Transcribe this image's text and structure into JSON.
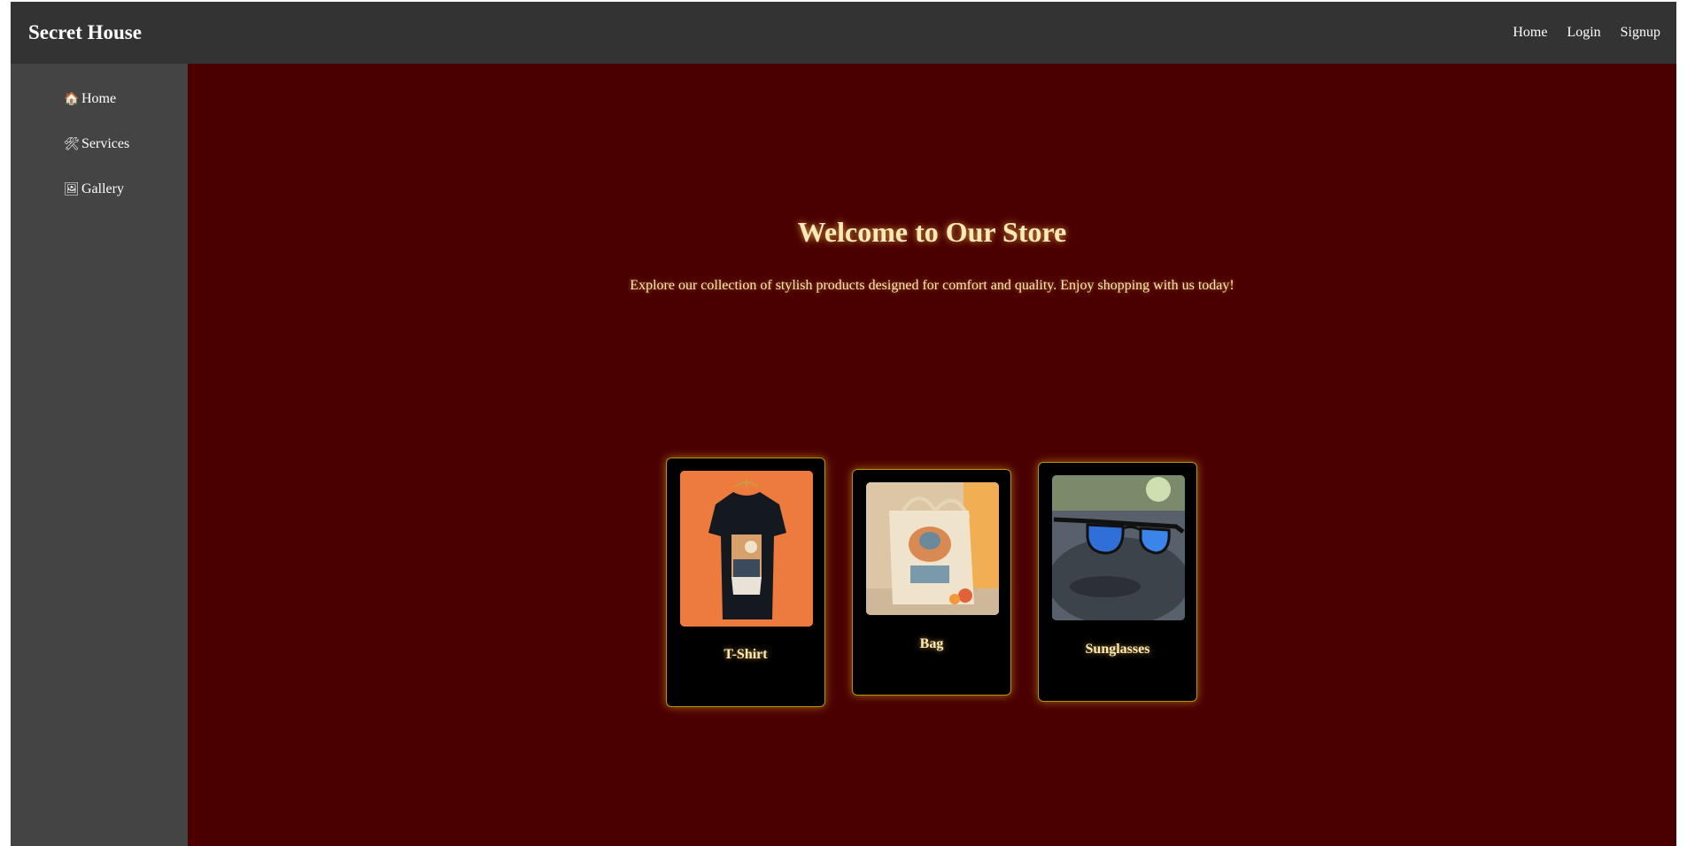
{
  "header": {
    "brand": "Secret House",
    "nav": [
      {
        "label": "Home"
      },
      {
        "label": "Login"
      },
      {
        "label": "Signup"
      }
    ]
  },
  "sidebar": {
    "items": [
      {
        "icon": "🏠",
        "icon_name": "house-icon",
        "label": "Home"
      },
      {
        "icon": "🛠",
        "icon_name": "tools-icon",
        "label": "Services"
      },
      {
        "icon": "🖼",
        "icon_name": "picture-icon",
        "label": "Gallery"
      }
    ]
  },
  "hero": {
    "title": "Welcome to Our Store",
    "subtitle": "Explore our collection of stylish products designed for comfort and quality. Enjoy shopping with us today!"
  },
  "products": [
    {
      "name": "T-Shirt",
      "image": "t-shirt-photo"
    },
    {
      "name": "Bag",
      "image": "bag-photo"
    },
    {
      "name": "Sunglasses",
      "image": "sunglasses-photo"
    }
  ],
  "colors": {
    "topbar": "#333333",
    "sidebar": "#444444",
    "main_bg": "#4b0000",
    "card_bg": "#000000",
    "card_border": "#b8920a",
    "heading_text": "#ffe9b8"
  }
}
